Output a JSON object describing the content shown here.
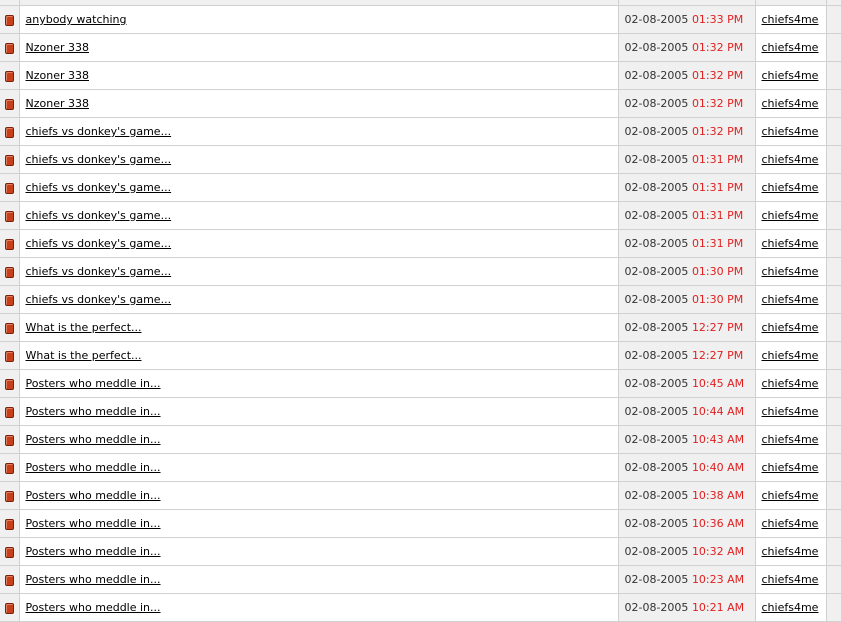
{
  "theme": {
    "bullet_color": "#c7401a",
    "time_color": "#e02020",
    "grid_color": "#d0d0d0",
    "alt_bg": "#f0f0f0"
  },
  "posts": [
    {
      "title": "anybody watching",
      "date": "02-08-2005",
      "time": "01:33 PM",
      "user": "chiefs4me"
    },
    {
      "title": "Nzoner 338",
      "date": "02-08-2005",
      "time": "01:32 PM",
      "user": "chiefs4me"
    },
    {
      "title": "Nzoner 338",
      "date": "02-08-2005",
      "time": "01:32 PM",
      "user": "chiefs4me"
    },
    {
      "title": "Nzoner 338",
      "date": "02-08-2005",
      "time": "01:32 PM",
      "user": "chiefs4me"
    },
    {
      "title": "chiefs vs donkey's game...",
      "date": "02-08-2005",
      "time": "01:32 PM",
      "user": "chiefs4me"
    },
    {
      "title": "chiefs vs donkey's game...",
      "date": "02-08-2005",
      "time": "01:31 PM",
      "user": "chiefs4me"
    },
    {
      "title": "chiefs vs donkey's game...",
      "date": "02-08-2005",
      "time": "01:31 PM",
      "user": "chiefs4me"
    },
    {
      "title": "chiefs vs donkey's game...",
      "date": "02-08-2005",
      "time": "01:31 PM",
      "user": "chiefs4me"
    },
    {
      "title": "chiefs vs donkey's game...",
      "date": "02-08-2005",
      "time": "01:31 PM",
      "user": "chiefs4me"
    },
    {
      "title": "chiefs vs donkey's game...",
      "date": "02-08-2005",
      "time": "01:30 PM",
      "user": "chiefs4me"
    },
    {
      "title": "chiefs vs donkey's game...",
      "date": "02-08-2005",
      "time": "01:30 PM",
      "user": "chiefs4me"
    },
    {
      "title": "What is the perfect...",
      "date": "02-08-2005",
      "time": "12:27 PM",
      "user": "chiefs4me"
    },
    {
      "title": "What is the perfect...",
      "date": "02-08-2005",
      "time": "12:27 PM",
      "user": "chiefs4me"
    },
    {
      "title": "Posters who meddle in...",
      "date": "02-08-2005",
      "time": "10:45 AM",
      "user": "chiefs4me"
    },
    {
      "title": "Posters who meddle in...",
      "date": "02-08-2005",
      "time": "10:44 AM",
      "user": "chiefs4me"
    },
    {
      "title": "Posters who meddle in...",
      "date": "02-08-2005",
      "time": "10:43 AM",
      "user": "chiefs4me"
    },
    {
      "title": "Posters who meddle in...",
      "date": "02-08-2005",
      "time": "10:40 AM",
      "user": "chiefs4me"
    },
    {
      "title": "Posters who meddle in...",
      "date": "02-08-2005",
      "time": "10:38 AM",
      "user": "chiefs4me"
    },
    {
      "title": "Posters who meddle in...",
      "date": "02-08-2005",
      "time": "10:36 AM",
      "user": "chiefs4me"
    },
    {
      "title": "Posters who meddle in...",
      "date": "02-08-2005",
      "time": "10:32 AM",
      "user": "chiefs4me"
    },
    {
      "title": "Posters who meddle in...",
      "date": "02-08-2005",
      "time": "10:23 AM",
      "user": "chiefs4me"
    },
    {
      "title": "Posters who meddle in...",
      "date": "02-08-2005",
      "time": "10:21 AM",
      "user": "chiefs4me"
    }
  ]
}
